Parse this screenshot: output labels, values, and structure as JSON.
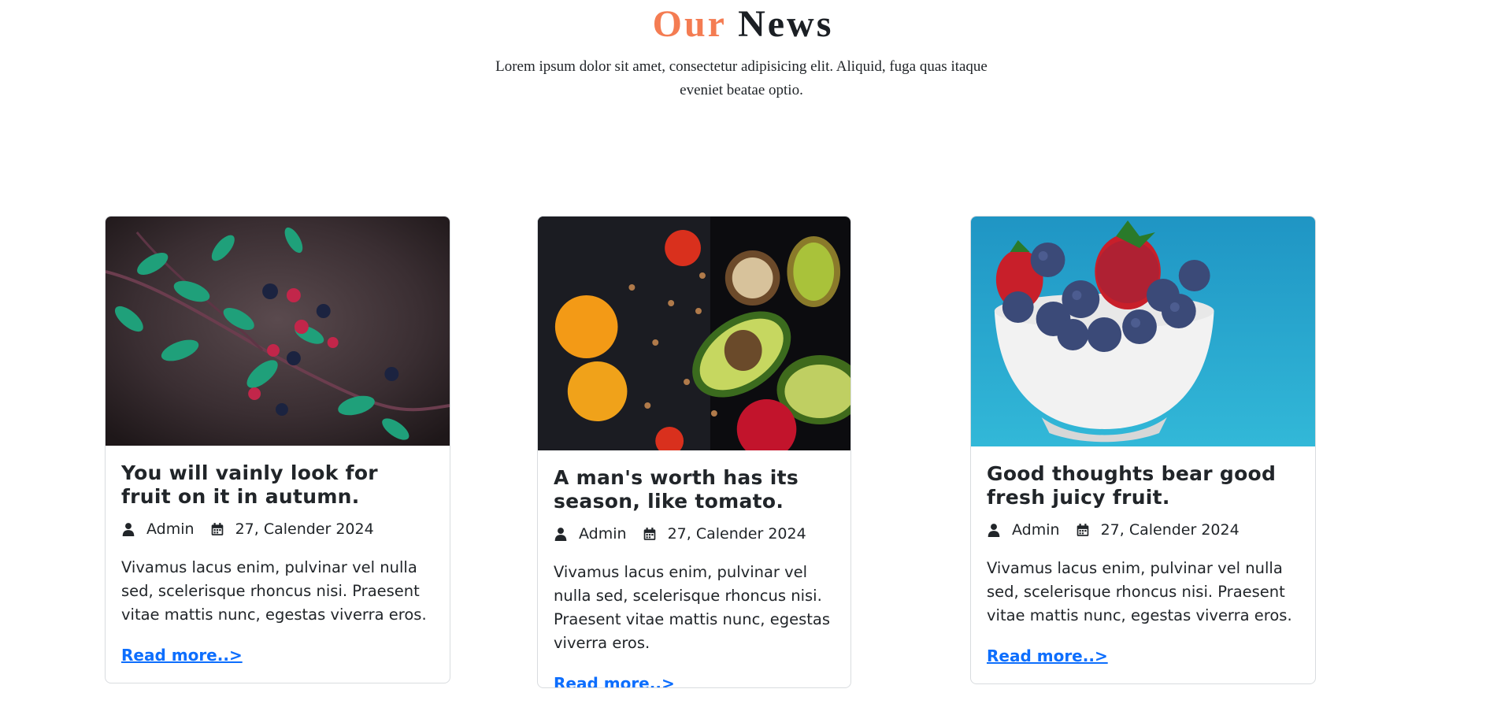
{
  "section": {
    "title_accent": "Our",
    "title_rest": "News",
    "intro": "Lorem ipsum dolor sit amet, consectetur adipisicing elit. Aliquid, fuga quas itaque eveniet beatae optio."
  },
  "cards": [
    {
      "title": "You will vainly look for fruit on it in autumn.",
      "author": "Admin",
      "date": "27, Calender 2024",
      "text": "Vivamus lacus enim, pulvinar vel nulla sed, scelerisque rhoncus nisi. Praesent vitae mattis nunc, egestas viverra eros.",
      "link": "Read more..>",
      "image": "blackberry-branch"
    },
    {
      "title": "A man's worth has its season, like tomato.",
      "author": "Admin",
      "date": "27, Calender 2024",
      "text": "Vivamus lacus enim, pulvinar vel nulla sed, scelerisque rhoncus nisi. Praesent vitae mattis nunc, egestas viverra eros.",
      "link": "Read more..>",
      "image": "fruits-and-avocado"
    },
    {
      "title": "Good thoughts bear good fresh juicy fruit.",
      "author": "Admin",
      "date": "27, Calender 2024",
      "text": "Vivamus lacus enim, pulvinar vel nulla sed, scelerisque rhoncus nisi. Praesent vitae mattis nunc, egestas viverra eros.",
      "link": "Read more..>",
      "image": "berry-bowl"
    }
  ],
  "icons": {
    "author": "user-icon",
    "date": "calendar-icon"
  },
  "colors": {
    "accent": "#f47c52",
    "link": "#0d6efd",
    "text": "#212529"
  }
}
